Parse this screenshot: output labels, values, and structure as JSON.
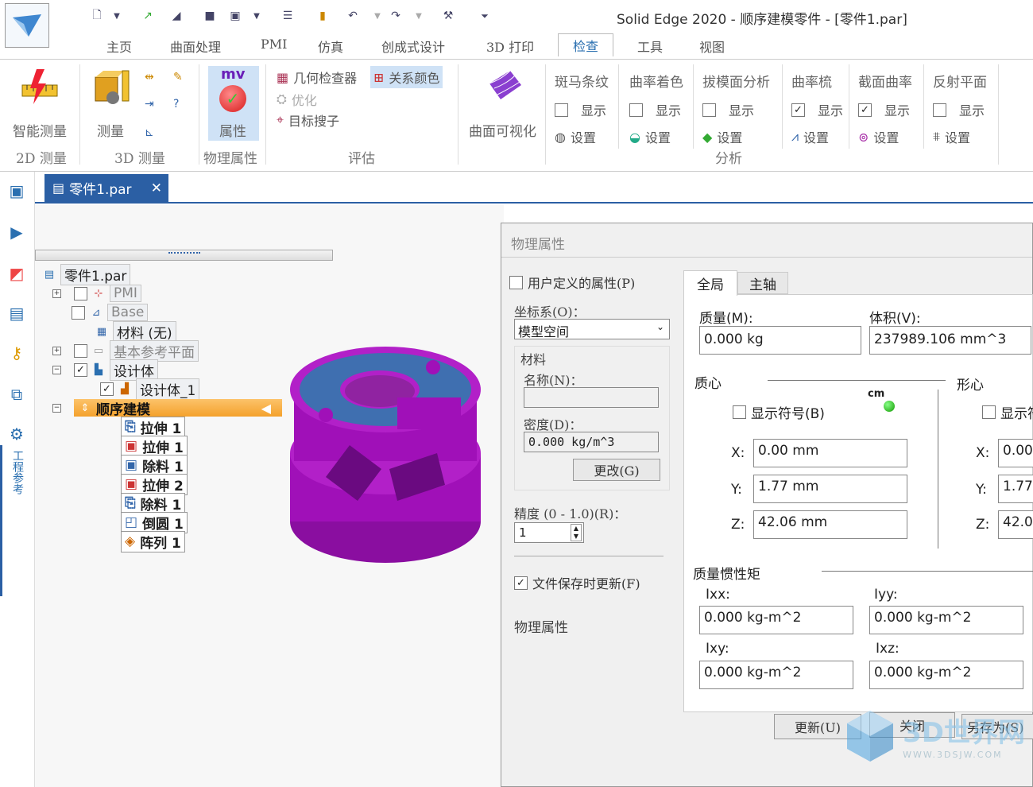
{
  "window_title": "Solid Edge 2020 - 顺序建模零件 - [零件1.par]",
  "menu_tabs": [
    "主页",
    "曲面处理",
    "PMI",
    "仿真",
    "创成式设计",
    "3D 打印",
    "检查",
    "工具",
    "视图"
  ],
  "active_tab": "检查",
  "ribbon": {
    "smart_measure": "智能测量",
    "group_2d": "2D 测量",
    "measure": "测量",
    "group_3d": "3D 测量",
    "properties": "属性",
    "properties_icon_text": "mv",
    "group_physical": "物理属性",
    "geom_checker": "几何检查器",
    "relation_color": "关系颜色",
    "optimize": "优化",
    "target_search": "目标搜子",
    "group_eval": "评估",
    "surface_vis": "曲面可视化",
    "analysis": [
      {
        "title": "斑马条纹",
        "show": "显示",
        "checked": false,
        "settings": "设置"
      },
      {
        "title": "曲率着色",
        "show": "显示",
        "checked": false,
        "settings": "设置"
      },
      {
        "title": "拔模面分析",
        "show": "显示",
        "checked": false,
        "settings": "设置"
      },
      {
        "title": "曲率梳",
        "show": "显示",
        "checked": true,
        "settings": "设置"
      },
      {
        "title": "截面曲率",
        "show": "显示",
        "checked": true,
        "settings": "设置"
      },
      {
        "title": "反射平面",
        "show": "显示",
        "checked": false,
        "settings": "设置"
      }
    ],
    "group_analysis": "分析"
  },
  "sidebar_vertical_label": "工程参考",
  "doc_tab": {
    "label": "零件1.par",
    "close": "✕"
  },
  "tree": [
    {
      "label": "零件1.par",
      "level": 0
    },
    {
      "label": "PMI",
      "level": 1,
      "grey": true
    },
    {
      "label": "Base",
      "level": 1,
      "grey": true
    },
    {
      "label": "材料 (无)",
      "level": 1
    },
    {
      "label": "基本参考平面",
      "level": 1,
      "grey": true
    },
    {
      "label": "设计体",
      "level": 1
    },
    {
      "label": "设计体_1",
      "level": 2
    },
    {
      "label": "顺序建模",
      "level": 1
    },
    {
      "label": "拉伸 1",
      "level": 2
    },
    {
      "label": "拉伸 1",
      "level": 2
    },
    {
      "label": "除料 1",
      "level": 2
    },
    {
      "label": "拉伸 2",
      "level": 2
    },
    {
      "label": "除料 1",
      "level": 2
    },
    {
      "label": "倒圆 1",
      "level": 2
    },
    {
      "label": "阵列 1",
      "level": 2
    }
  ],
  "dialog": {
    "title": "物理属性",
    "user_defined": "用户定义的属性(P)",
    "coord_label": "坐标系(O)：",
    "coord_value": "模型空间",
    "material_group": "材料",
    "name_label": "名称(N)：",
    "name_value": "",
    "density_label": "密度(D)：",
    "density_value": "0.000 kg/m^3",
    "change_btn": "更改(G)",
    "precision_label": "精度 (0 - 1.0)(R)：",
    "precision_value": "1",
    "update_on_save": "文件保存时更新(F)",
    "footer_label": "物理属性",
    "tabs": [
      "全局",
      "主轴"
    ],
    "mass_label": "质量(M):",
    "mass_value": "0.000 kg",
    "volume_label": "体积(V):",
    "volume_value": "237989.106 mm^3",
    "centroid_mass": "质心",
    "centroid_shape": "形心",
    "cm_marker": "cm",
    "show_symbol": "显示符号(B)",
    "show_symbol2": "显示符",
    "x_label": "X:",
    "y_label": "Y:",
    "z_label": "Z:",
    "x_value": "0.00 mm",
    "y_value": "1.77 mm",
    "z_value": "42.06 mm",
    "x_value2": "0.00",
    "y_value2": "1.77",
    "z_value2": "42.0",
    "inertia_title": "质量惯性矩",
    "ixx_label": "Ixx:",
    "ixx_value": "0.000 kg-m^2",
    "iyy_label": "Iyy:",
    "iyy_value": "0.000 kg-m^2",
    "ixy_label": "Ixy:",
    "ixy_value": "0.000 kg-m^2",
    "ixz_label": "Ixz:",
    "ixz_value": "0.000 kg-m^2",
    "update_btn": "更新(U)",
    "close_btn": "关闭",
    "saveas_btn": "另存为(S)"
  },
  "watermark": {
    "text": "3D世界网",
    "url": "WWW.3DSJW.COM"
  },
  "colors": {
    "accent": "#2b5fa4",
    "part": "#a010b8",
    "face": "#3f6fb0",
    "highlight": "#f4a12c"
  }
}
